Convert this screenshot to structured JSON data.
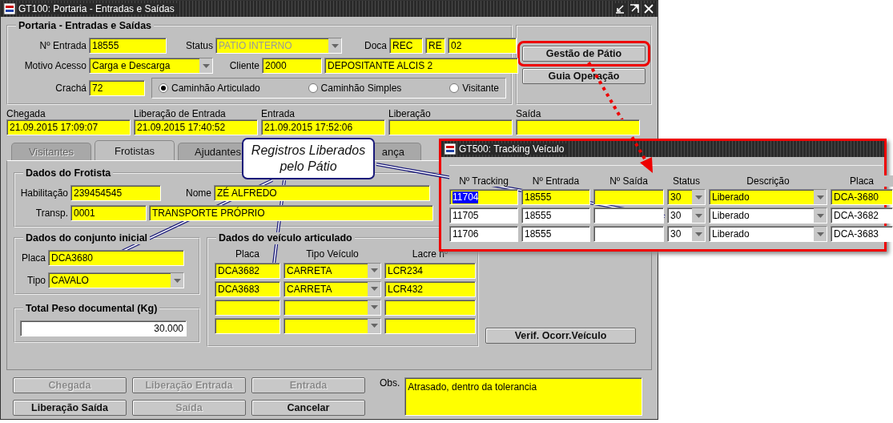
{
  "main_window": {
    "title": "GT100: Portaria - Entradas e Saídas"
  },
  "header": {
    "title": "Portaria - Entradas e Saídas",
    "entry": {
      "label": "Nº Entrada",
      "value": "18555"
    },
    "status": {
      "label": "Status",
      "value": "PATIO INTERNO",
      "disabled": true
    },
    "doca": {
      "label": "Doca",
      "values": [
        "REC",
        "RE",
        "02"
      ]
    },
    "motivo": {
      "label": "Motivo Acesso",
      "value": "Carga e Descarga"
    },
    "cliente": {
      "label": "Cliente",
      "code": "2000",
      "name": "DEPOSITANTE ALCIS 2"
    },
    "cracha": {
      "label": "Crachá",
      "value": "72"
    },
    "vehicle_types": [
      {
        "label": "Caminhão Articulado",
        "selected": true
      },
      {
        "label": "Caminhão Simples",
        "selected": false
      },
      {
        "label": "Visitante",
        "selected": false
      }
    ]
  },
  "side_buttons": [
    {
      "label": "Gestão de Pátio",
      "highlighted": true
    },
    {
      "label": "Guia Operação",
      "highlighted": false
    }
  ],
  "dates": [
    {
      "label": "Chegada",
      "value": "21.09.2015 17:09:07"
    },
    {
      "label": "Liberação de Entrada",
      "value": "21.09.2015 17:40:52"
    },
    {
      "label": "Entrada",
      "value": "21.09.2015 17:52:06"
    },
    {
      "label": "Liberação"
    },
    {
      "label": "Saída"
    }
  ],
  "tabs": [
    {
      "label": "Visitantes",
      "selected": false,
      "disabled": true
    },
    {
      "label": "Frotistas",
      "selected": true,
      "disabled": false
    },
    {
      "label": "Ajudantes",
      "selected": false,
      "disabled": false
    },
    {
      "label": "ança",
      "selected": false,
      "disabled": false
    }
  ],
  "frotista": {
    "title": "Dados do Frotista",
    "habilitacao": {
      "label": "Habilitação",
      "value": "239454545"
    },
    "nome": {
      "label": "Nome",
      "value": "ZÉ ALFREDO"
    },
    "transp": {
      "label": "Transp.",
      "code": "0001",
      "name": "TRANSPORTE PRÓPRIO"
    }
  },
  "conjunto": {
    "title": "Dados do conjunto inicial",
    "placa": {
      "label": "Placa",
      "value": "DCA3680"
    },
    "tipo": {
      "label": "Tipo",
      "value": "CAVALO"
    }
  },
  "peso": {
    "title": "Total Peso documental (Kg)",
    "value": "30.000"
  },
  "articulado": {
    "title": "Dados do veículo articulado",
    "columns": [
      "Placa",
      "Tipo Veículo",
      "Lacre nº"
    ],
    "rows": [
      {
        "placa": "DCA3682",
        "tipo": "CARRETA",
        "lacre": "LCR234"
      },
      {
        "placa": "DCA3683",
        "tipo": "CARRETA",
        "lacre": "LCR432"
      },
      {},
      {}
    ]
  },
  "verif_button": "Verif. Ocorr.Veículo",
  "actions": [
    {
      "label": "Chegada",
      "disabled": true
    },
    {
      "label": "Liberação Entrada",
      "disabled": true
    },
    {
      "label": "Entrada",
      "disabled": true
    },
    {
      "label": "Liberação Saída",
      "disabled": false
    },
    {
      "label": "Saída",
      "disabled": true
    },
    {
      "label": "Cancelar",
      "disabled": false
    }
  ],
  "obs": {
    "label": "Obs.",
    "value": "Atrasado, dentro da tolerancia"
  },
  "tracking_window": {
    "title": "GT500: Tracking Veículo",
    "columns": [
      "Nº Tracking",
      "Nº Entrada",
      "Nº Saída",
      "Status",
      "Descrição",
      "Placa"
    ],
    "rows": [
      {
        "tracking": "11704",
        "entrada": "18555",
        "status": "30",
        "descricao": "Liberado",
        "placa": "DCA-3680",
        "selected": true
      },
      {
        "tracking": "11705",
        "entrada": "18555",
        "status": "30",
        "descricao": "Liberado",
        "placa": "DCA-3682",
        "selected": false
      },
      {
        "tracking": "11706",
        "entrada": "18555",
        "status": "30",
        "descricao": "Liberado",
        "placa": "DCA-3683",
        "selected": false
      }
    ]
  },
  "callout": {
    "text": "Registros Liberados pelo Pátio"
  }
}
